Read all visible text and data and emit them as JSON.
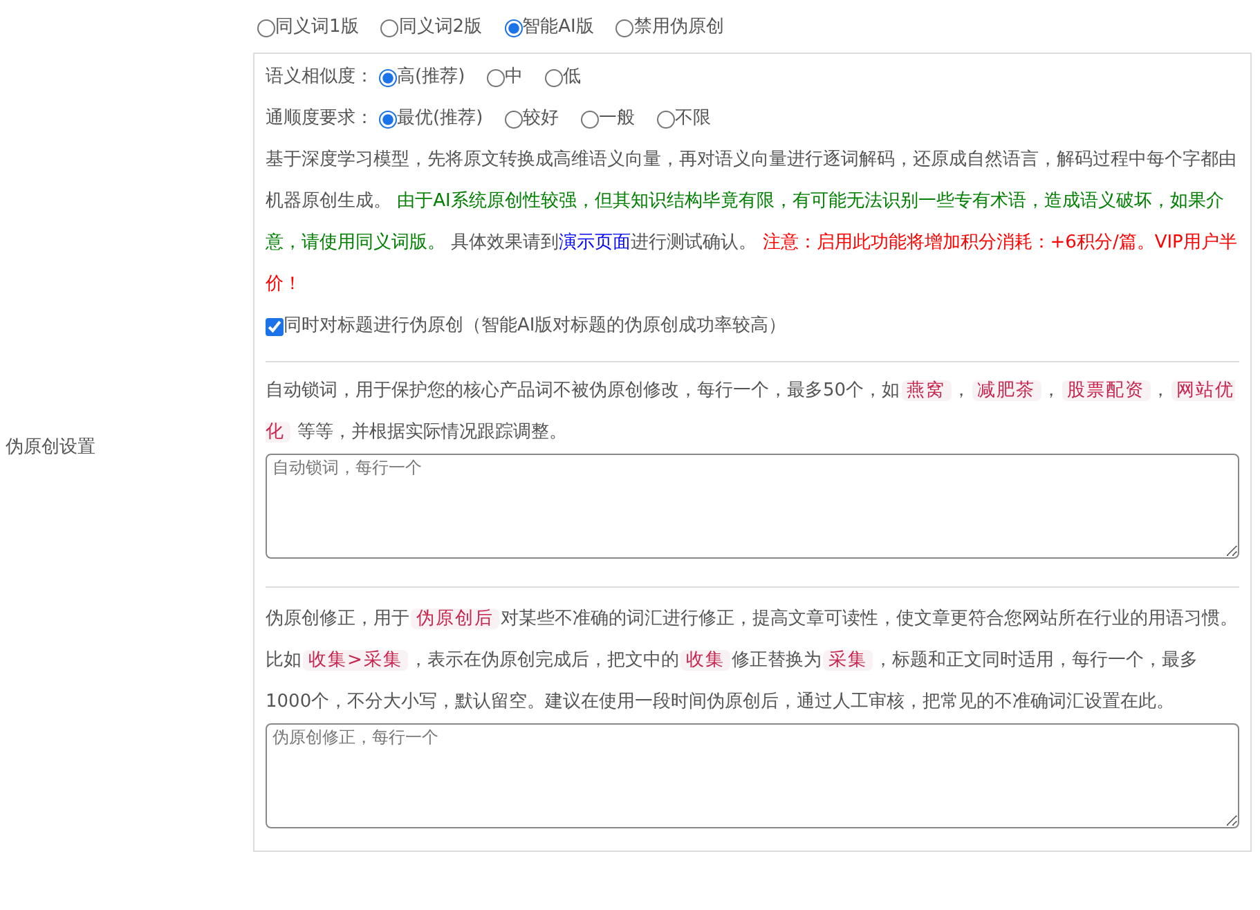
{
  "side_label": "伪原创设置",
  "modes": [
    {
      "label": "同义词1版",
      "selected": false
    },
    {
      "label": "同义词2版",
      "selected": false
    },
    {
      "label": "智能AI版",
      "selected": true
    },
    {
      "label": "禁用伪原创",
      "selected": false
    }
  ],
  "option_rows": [
    {
      "label": "语义相似度：",
      "options": [
        {
          "label": "高(推荐)",
          "selected": true
        },
        {
          "label": "中",
          "selected": false
        },
        {
          "label": "低",
          "selected": false
        }
      ]
    },
    {
      "label": "通顺度要求：",
      "options": [
        {
          "label": "最优(推荐)",
          "selected": true
        },
        {
          "label": "较好",
          "selected": false
        },
        {
          "label": "一般",
          "selected": false
        },
        {
          "label": "不限",
          "selected": false
        }
      ]
    }
  ],
  "description": [
    {
      "kind": "plain",
      "text": "基于深度学习模型，先将原文转换成高维语义向量，再对语义向量进行逐词解码，还原成自然语言，解码过程中每个字都由机器原创生成。 "
    },
    {
      "kind": "green",
      "text": "由于AI系统原创性较强，但其知识结构毕竟有限，有可能无法识别一些专有术语，造成语义破坏，如果介意，请使用同义词版。"
    },
    {
      "kind": "plain",
      "text": " 具体效果请到"
    },
    {
      "kind": "link",
      "text": "演示页面"
    },
    {
      "kind": "plain",
      "text": "进行测试确认。 "
    },
    {
      "kind": "red",
      "text": "注意：启用此功能将增加积分消耗：+6积分/篇。VIP用户半价！"
    }
  ],
  "title_checkbox": {
    "label": "同时对标题进行伪原创（智能AI版对标题的伪原创成功率较高）",
    "checked": true
  },
  "lock_words": {
    "description": [
      {
        "kind": "plain",
        "text": "自动锁词，用于保护您的核心产品词不被伪原创修改，每行一个，最多50个，如"
      },
      {
        "kind": "code",
        "text": "燕窝"
      },
      {
        "kind": "plain",
        "text": "，"
      },
      {
        "kind": "code",
        "text": "减肥茶"
      },
      {
        "kind": "plain",
        "text": "，"
      },
      {
        "kind": "code",
        "text": "股票配资"
      },
      {
        "kind": "plain",
        "text": "，"
      },
      {
        "kind": "code",
        "text": "网站优化"
      },
      {
        "kind": "plain",
        "text": " 等等，并根据实际情况跟踪调整。"
      }
    ],
    "placeholder": "自动锁词，每行一个"
  },
  "correction": {
    "description": [
      {
        "kind": "plain",
        "text": "伪原创修正，用于"
      },
      {
        "kind": "code",
        "text": "伪原创后"
      },
      {
        "kind": "plain",
        "text": "对某些不准确的词汇进行修正，提高文章可读性，使文章更符合您网站所在行业的用语习惯。比如"
      },
      {
        "kind": "code",
        "text": "收集>采集"
      },
      {
        "kind": "plain",
        "text": "，表示在伪原创完成后，把文中的"
      },
      {
        "kind": "code",
        "text": "收集"
      },
      {
        "kind": "plain",
        "text": "修正替换为"
      },
      {
        "kind": "code",
        "text": "采集"
      },
      {
        "kind": "plain",
        "text": "，标题和正文同时适用，每行一个，最多1000个，不分大小写，默认留空。建议在使用一段时间伪原创后，通过人工审核，把常见的不准确词汇设置在此。"
      }
    ],
    "placeholder": "伪原创修正，每行一个"
  }
}
